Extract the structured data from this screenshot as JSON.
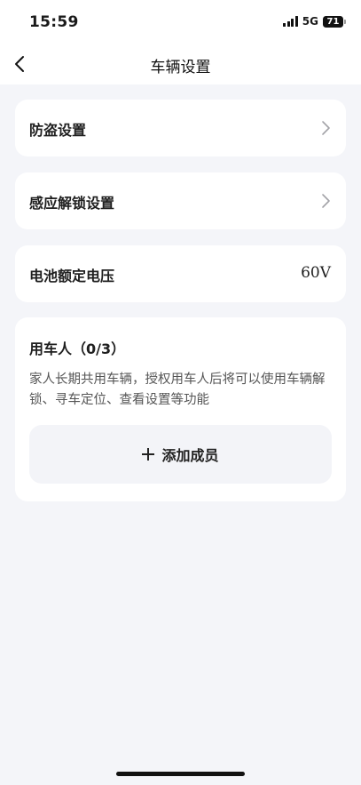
{
  "status_bar": {
    "time": "15:59",
    "network": "5G",
    "battery_level": "71"
  },
  "nav": {
    "back_icon": "chevron-left-icon",
    "title": "车辆设置"
  },
  "settings": {
    "anti_theft": {
      "label": "防盗设置",
      "icon": "chevron-right-icon"
    },
    "proximity_unlock": {
      "label": "感应解锁设置",
      "icon": "chevron-right-icon"
    },
    "battery_voltage": {
      "label": "电池额定电压",
      "value": "60V"
    }
  },
  "users": {
    "title": "用车人（0/3）",
    "description": "家人长期共用车辆，授权用车人后将可以使用车辆解锁、寻车定位、查看设置等功能",
    "add_button_label": "添加成员",
    "add_icon": "plus-icon"
  },
  "colors": {
    "page_background": "#f4f5f9",
    "card_background": "#ffffff",
    "button_background": "#f3f4f8"
  }
}
